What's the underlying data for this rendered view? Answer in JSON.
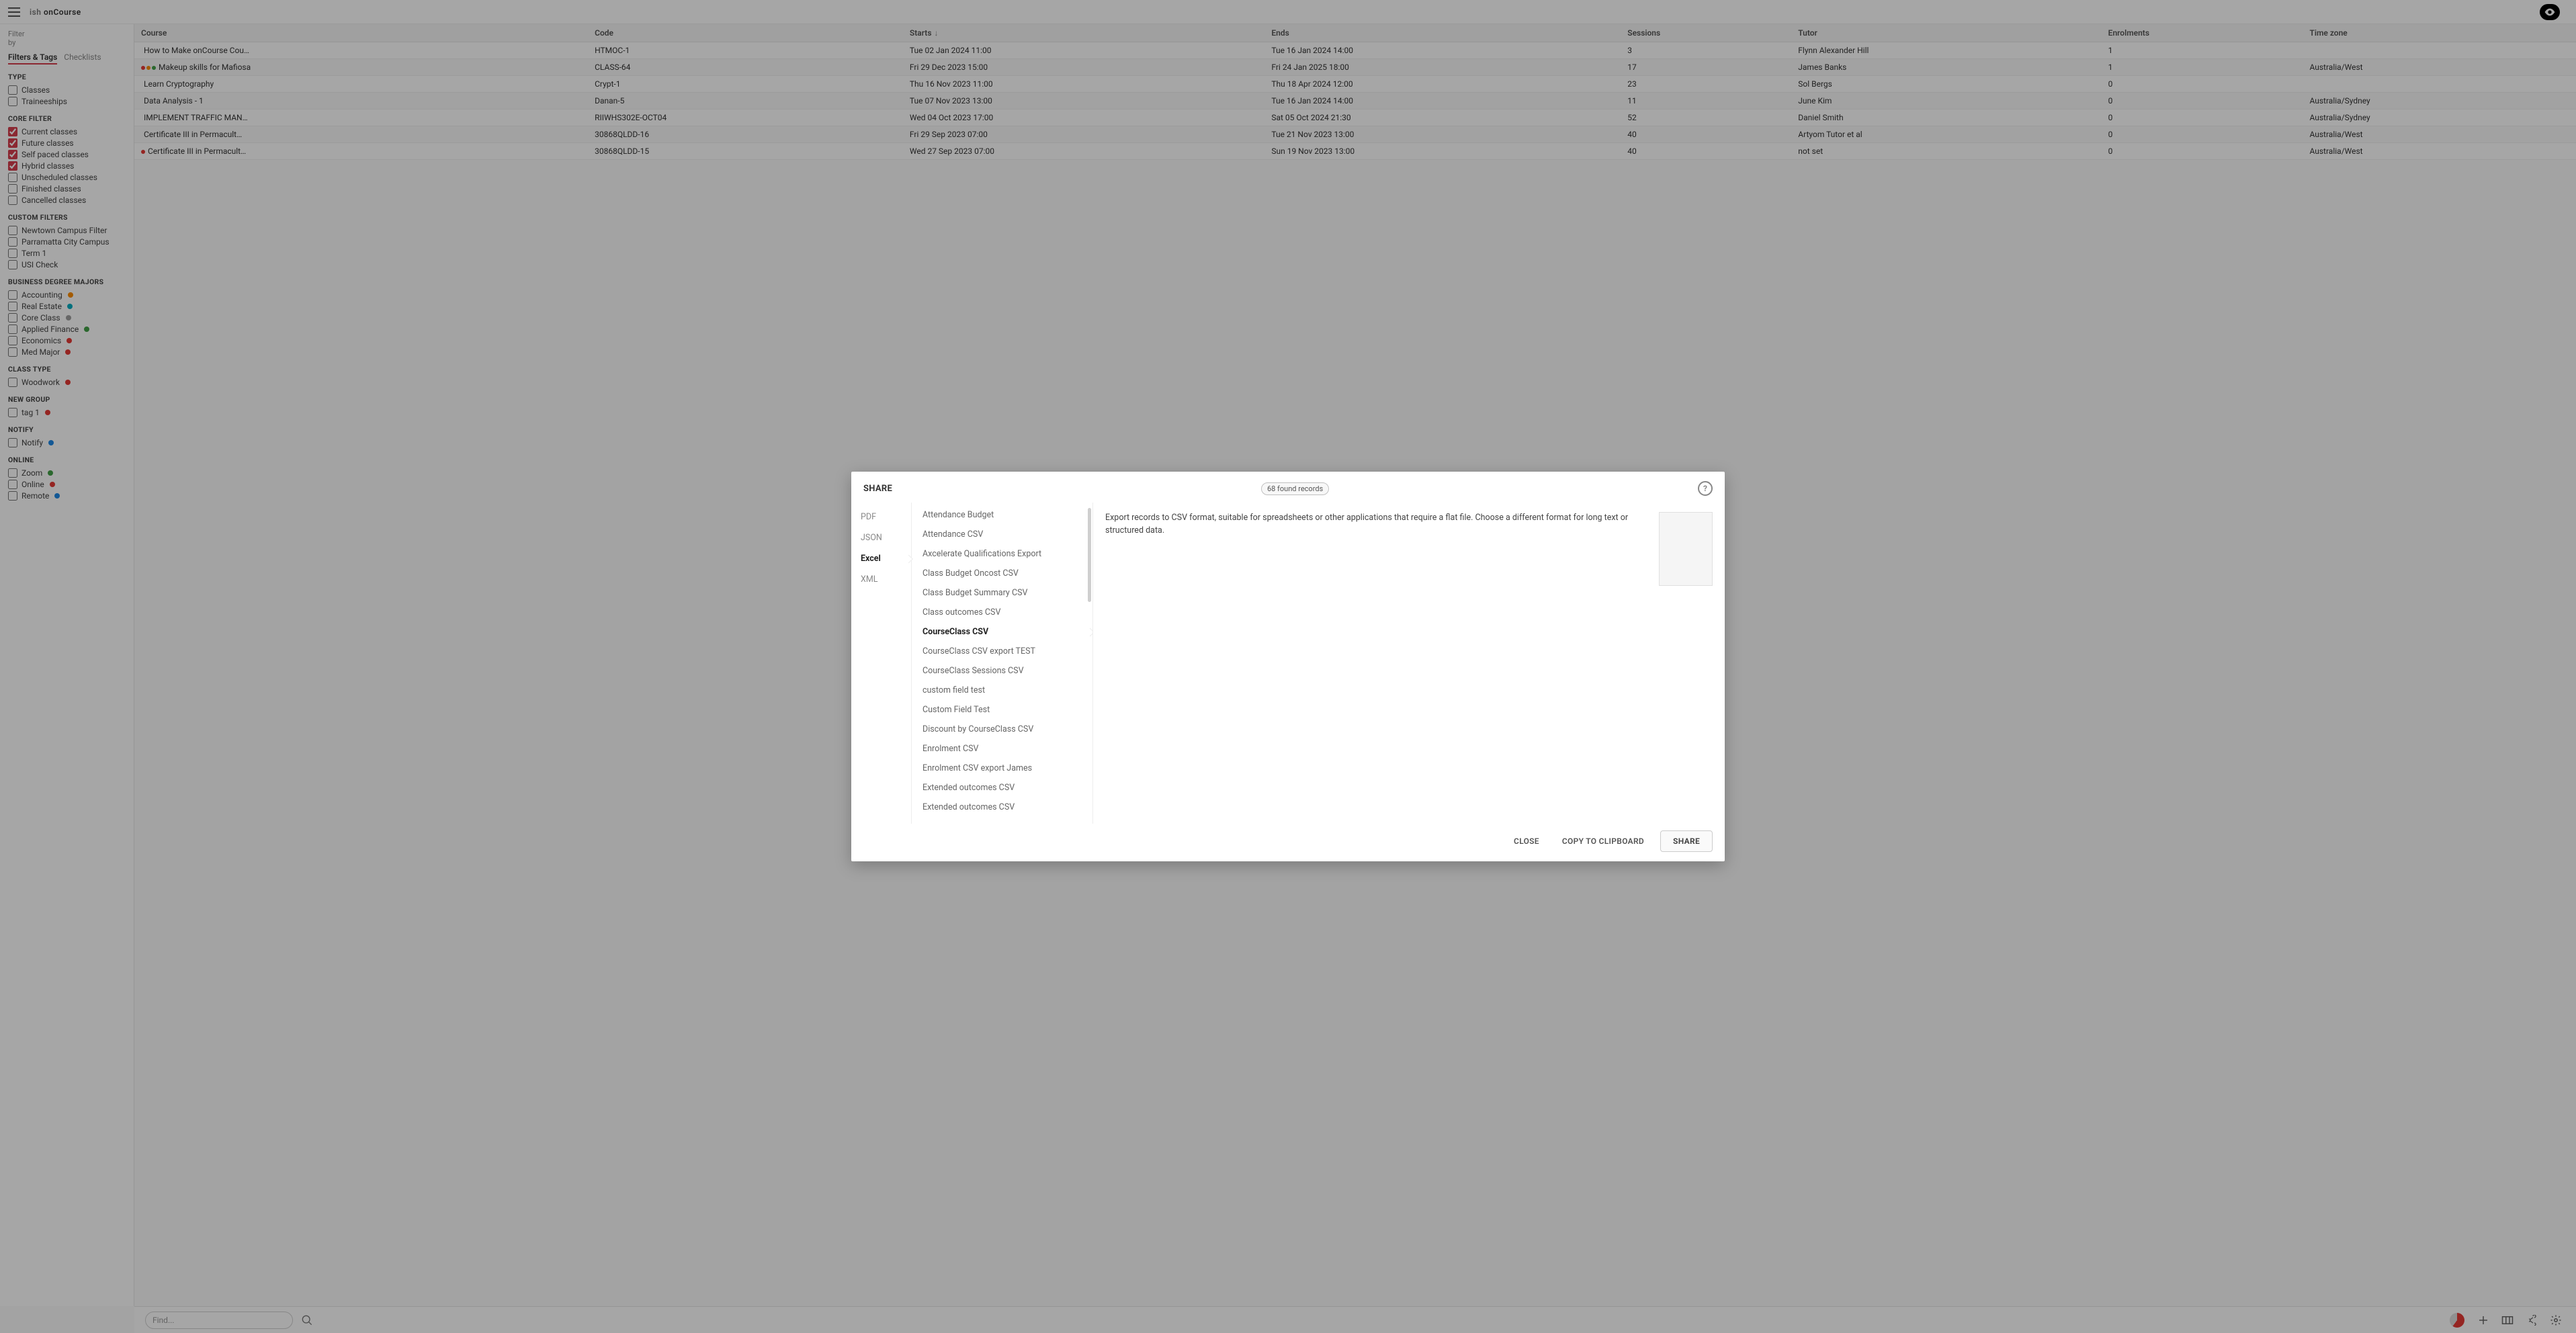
{
  "header": {
    "logo_prefix": "ish",
    "logo_main": "onCourse"
  },
  "sidebar": {
    "filter_by_line1": "Filter",
    "filter_by_line2": "by",
    "tabs": [
      {
        "label": "Filters & Tags",
        "active": true
      },
      {
        "label": "Checklists",
        "active": false
      }
    ],
    "sections": [
      {
        "title": "TYPE",
        "items": [
          {
            "label": "Classes",
            "checked": false
          },
          {
            "label": "Traineeships",
            "checked": false
          }
        ]
      },
      {
        "title": "CORE FILTER",
        "items": [
          {
            "label": "Current classes",
            "checked": true
          },
          {
            "label": "Future classes",
            "checked": true
          },
          {
            "label": "Self paced classes",
            "checked": true
          },
          {
            "label": "Hybrid classes",
            "checked": true
          },
          {
            "label": "Unscheduled classes",
            "checked": false
          },
          {
            "label": "Finished classes",
            "checked": false
          },
          {
            "label": "Cancelled classes",
            "checked": false
          }
        ]
      },
      {
        "title": "CUSTOM FILTERS",
        "items": [
          {
            "label": "Newtown Campus Filter",
            "checked": false
          },
          {
            "label": "Parramatta City Campus",
            "checked": false
          },
          {
            "label": "Term 1",
            "checked": false
          },
          {
            "label": "USI Check",
            "checked": false
          }
        ]
      },
      {
        "title": "BUSINESS DEGREE MAJORS",
        "items": [
          {
            "label": "Accounting",
            "checked": false,
            "dot": "dot-orange"
          },
          {
            "label": "Real Estate",
            "checked": false,
            "dot": "dot-teal"
          },
          {
            "label": "Core Class",
            "checked": false,
            "dot": "dot-grey"
          },
          {
            "label": "Applied Finance",
            "checked": false,
            "dot": "dot-green"
          },
          {
            "label": "Economics",
            "checked": false,
            "dot": "dot-red"
          },
          {
            "label": "Med Major",
            "checked": false,
            "dot": "dot-red"
          }
        ]
      },
      {
        "title": "CLASS TYPE",
        "items": [
          {
            "label": "Woodwork",
            "checked": false,
            "dot": "dot-red"
          }
        ]
      },
      {
        "title": "NEW GROUP",
        "items": [
          {
            "label": "tag 1",
            "checked": false,
            "dot": "dot-red"
          }
        ]
      },
      {
        "title": "NOTIFY",
        "items": [
          {
            "label": "Notify",
            "checked": false,
            "dot": "dot-blue"
          }
        ]
      },
      {
        "title": "ONLINE",
        "items": [
          {
            "label": "Zoom",
            "checked": false,
            "dot": "dot-green"
          },
          {
            "label": "Online",
            "checked": false,
            "dot": "dot-red"
          },
          {
            "label": "Remote",
            "checked": false,
            "dot": "dot-blue"
          }
        ]
      }
    ]
  },
  "table": {
    "columns": [
      "Course",
      "Code",
      "Starts",
      "Ends",
      "Sessions",
      "Tutor",
      "Enrolments",
      "Time zone"
    ],
    "sort_col": "Starts",
    "rows": [
      {
        "dots": [],
        "course": "How to Make onCourse Cou…",
        "code": "HTMOC-1",
        "starts": "Tue 02 Jan 2024 11:00",
        "ends": "Tue 16 Jan 2024 14:00",
        "sessions": "3",
        "tutor": "Flynn Alexander Hill",
        "enrolments": "1",
        "tz": ""
      },
      {
        "dots": [
          "dot-red",
          "dot-orange",
          "dot-green"
        ],
        "course": "Makeup skills for Mafiosa",
        "code": "CLASS-64",
        "starts": "Fri 29 Dec 2023 15:00",
        "ends": "Fri 24 Jan 2025 18:00",
        "sessions": "17",
        "tutor": "James Banks",
        "enrolments": "1",
        "tz": "Australia/West"
      },
      {
        "dots": [],
        "course": "Learn Cryptography",
        "code": "Crypt-1",
        "starts": "Thu 16 Nov 2023 11:00",
        "ends": "Thu 18 Apr 2024 12:00",
        "sessions": "23",
        "tutor": "Sol Bergs",
        "enrolments": "0",
        "tz": ""
      },
      {
        "dots": [],
        "course": "Data Analysis - 1",
        "code": "Danan-5",
        "starts": "Tue 07 Nov 2023 13:00",
        "ends": "Tue 16 Jan 2024 14:00",
        "sessions": "11",
        "tutor": "June Kim",
        "enrolments": "0",
        "tz": "Australia/Sydney"
      },
      {
        "dots": [],
        "course": "IMPLEMENT TRAFFIC MAN…",
        "code": "RIIWHS302E-OCT04",
        "starts": "Wed 04 Oct 2023 17:00",
        "ends": "Sat 05 Oct 2024 21:30",
        "sessions": "52",
        "tutor": "Daniel Smith",
        "enrolments": "0",
        "tz": "Australia/Sydney"
      },
      {
        "dots": [],
        "course": "Certificate III in Permacult…",
        "code": "30868QLDD-16",
        "starts": "Fri 29 Sep 2023 07:00",
        "ends": "Tue 21 Nov 2023 13:00",
        "sessions": "40",
        "tutor": "Artyom Tutor et al",
        "enrolments": "0",
        "tz": "Australia/West"
      },
      {
        "dots": [
          "dot-red"
        ],
        "course": "Certificate III in Permacult…",
        "code": "30868QLDD-15",
        "starts": "Wed 27 Sep 2023 07:00",
        "ends": "Sun 19 Nov 2023 13:00",
        "sessions": "40",
        "tutor": "not set",
        "enrolments": "0",
        "tz": "Australia/West"
      }
    ]
  },
  "bottom": {
    "search_placeholder": "Find..."
  },
  "modal": {
    "title": "SHARE",
    "badge": "68 found records",
    "formats": [
      {
        "label": "PDF",
        "active": false
      },
      {
        "label": "JSON",
        "active": false
      },
      {
        "label": "Excel",
        "active": true
      },
      {
        "label": "XML",
        "active": false
      }
    ],
    "templates": [
      {
        "label": "Attendance Budget",
        "active": false
      },
      {
        "label": "Attendance CSV",
        "active": false
      },
      {
        "label": "Axcelerate Qualifications Export",
        "active": false
      },
      {
        "label": "Class Budget Oncost CSV",
        "active": false
      },
      {
        "label": "Class Budget Summary CSV",
        "active": false
      },
      {
        "label": "Class outcomes CSV",
        "active": false
      },
      {
        "label": "CourseClass CSV",
        "active": true
      },
      {
        "label": "CourseClass CSV export TEST",
        "active": false
      },
      {
        "label": "CourseClass Sessions CSV",
        "active": false
      },
      {
        "label": "custom field test",
        "active": false
      },
      {
        "label": "Custom Field Test",
        "active": false
      },
      {
        "label": "Discount by CourseClass CSV",
        "active": false
      },
      {
        "label": "Enrolment CSV",
        "active": false
      },
      {
        "label": "Enrolment CSV export James",
        "active": false
      },
      {
        "label": "Extended outcomes CSV",
        "active": false
      },
      {
        "label": "Extended outcomes CSV",
        "active": false
      }
    ],
    "description": "Export records to CSV format, suitable for spreadsheets or other applications that require a flat file. Choose a different format for long text or structured data.",
    "buttons": {
      "close": "CLOSE",
      "copy": "COPY TO CLIPBOARD",
      "share": "SHARE"
    }
  }
}
